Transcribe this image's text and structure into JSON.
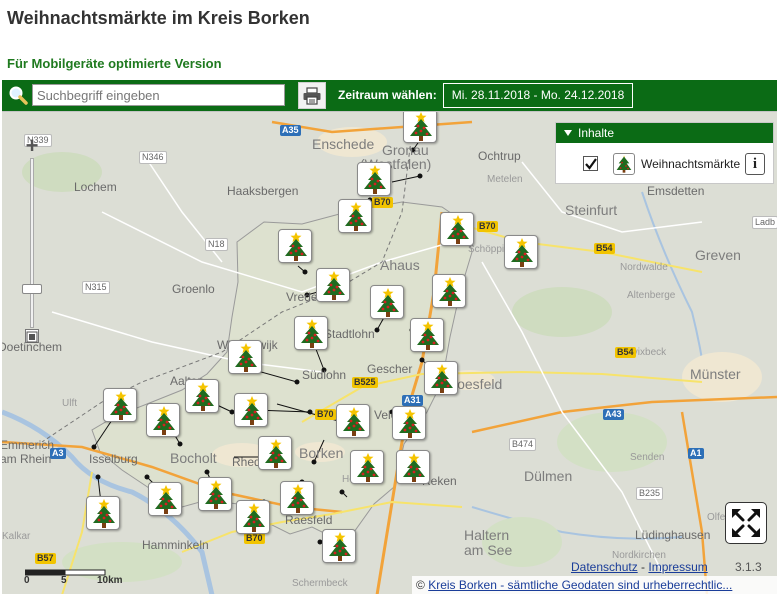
{
  "page": {
    "title": "Weihnachtsmärkte im Kreis Borken",
    "mobile_link": "Für Mobilgeräte optimierte Version"
  },
  "toolbar": {
    "search_placeholder": "Suchbegriff eingeben",
    "period_label": "Zeitraum wählen:",
    "period_value": "Mi. 28.11.2018 - Mo. 24.12.2018",
    "search_icon": "magnifier-icon",
    "print_icon": "printer-icon"
  },
  "layer_panel": {
    "title": "Inhalte",
    "layer_label": "Weihnachtsmärkte",
    "layer_checked": true,
    "info_label": "i"
  },
  "map": {
    "places": [
      {
        "name": "Enschede",
        "class": "big"
      },
      {
        "name": "Gronau",
        "class": "big"
      },
      {
        "name": "(Westfalen)",
        "class": "big"
      },
      {
        "name": "Ochtrup",
        "class": "mid"
      },
      {
        "name": "Emsdetten",
        "class": "mid"
      },
      {
        "name": "Steinfurt",
        "class": "big"
      },
      {
        "name": "Metelen",
        "class": "small"
      },
      {
        "name": "Lochem",
        "class": "mid"
      },
      {
        "name": "Haaksbergen",
        "class": "mid"
      },
      {
        "name": "Groenlo",
        "class": "mid"
      },
      {
        "name": "Ahaus",
        "class": "big"
      },
      {
        "name": "Schöppingen",
        "class": "small"
      },
      {
        "name": "Greven",
        "class": "big"
      },
      {
        "name": "Nordwalde",
        "class": "small"
      },
      {
        "name": "Altenberge",
        "class": "small"
      },
      {
        "name": "Vreden",
        "class": "mid"
      },
      {
        "name": "Stadtlohn",
        "class": "mid"
      },
      {
        "name": "Gescher",
        "class": "mid"
      },
      {
        "name": "Winterswijk",
        "class": "mid"
      },
      {
        "name": "Doetinchem",
        "class": "mid"
      },
      {
        "name": "Südlohn",
        "class": "mid"
      },
      {
        "name": "Coesfeld",
        "class": "big"
      },
      {
        "name": "Havixbeck",
        "class": "small"
      },
      {
        "name": "Münster",
        "class": "big"
      },
      {
        "name": "Aalten",
        "class": "mid"
      },
      {
        "name": "Velen",
        "class": "mid"
      },
      {
        "name": "Ulft",
        "class": "small"
      },
      {
        "name": "Emmerich",
        "class": "mid"
      },
      {
        "name": "am Rhein",
        "class": "mid"
      },
      {
        "name": "Isselburg",
        "class": "mid"
      },
      {
        "name": "Bocholt",
        "class": "big"
      },
      {
        "name": "Rhede",
        "class": "mid"
      },
      {
        "name": "Borken",
        "class": "big"
      },
      {
        "name": "Heiden",
        "class": "small"
      },
      {
        "name": "Reken",
        "class": "mid"
      },
      {
        "name": "Dülmen",
        "class": "big"
      },
      {
        "name": "Senden",
        "class": "small"
      },
      {
        "name": "Lüdinghausen",
        "class": "mid"
      },
      {
        "name": "Raesfeld",
        "class": "mid"
      },
      {
        "name": "Haltern",
        "class": "big"
      },
      {
        "name": "am See",
        "class": "big"
      },
      {
        "name": "Kalkar",
        "class": "small"
      },
      {
        "name": "Hamminkeln",
        "class": "mid"
      },
      {
        "name": "Schermbeck",
        "class": "small"
      },
      {
        "name": "Nordkirchen",
        "class": "small"
      },
      {
        "name": "Olfen",
        "class": "small"
      }
    ],
    "roads": [
      {
        "label": "N339",
        "kind": "n"
      },
      {
        "label": "A35",
        "kind": "a"
      },
      {
        "label": "N346",
        "kind": "n"
      },
      {
        "label": "N18",
        "kind": "n"
      },
      {
        "label": "N315",
        "kind": "n"
      },
      {
        "label": "B70",
        "kind": "b"
      },
      {
        "label": "B70",
        "kind": "b"
      },
      {
        "label": "B54",
        "kind": "b"
      },
      {
        "label": "B54",
        "kind": "b"
      },
      {
        "label": "B525",
        "kind": "b"
      },
      {
        "label": "A31",
        "kind": "a"
      },
      {
        "label": "A43",
        "kind": "a"
      },
      {
        "label": "B70",
        "kind": "b"
      },
      {
        "label": "B474",
        "kind": "n"
      },
      {
        "label": "A3",
        "kind": "a"
      },
      {
        "label": "A1",
        "kind": "a"
      },
      {
        "label": "B235",
        "kind": "n"
      },
      {
        "label": "B70",
        "kind": "b"
      },
      {
        "label": "B57",
        "kind": "b"
      },
      {
        "label": "Ladb",
        "kind": "n"
      }
    ],
    "marker_icon": "christmas-tree-icon",
    "marker_count": 30
  },
  "scale": {
    "labels": [
      "0",
      "5",
      "10km"
    ]
  },
  "footer": {
    "privacy": "Datenschutz",
    "separator": "-",
    "imprint": "Impressum",
    "version": "3.1.3",
    "copyright_symbol": "©",
    "copyright_link": "Kreis Borken - sämtliche Geodaten sind urheberrechtlic..."
  },
  "colors": {
    "toolbar_green": "#0b6b15",
    "tree_green": "#1f6b1f",
    "tree_trunk": "#7a3f12",
    "ornament_red": "#d42020",
    "star_yellow": "#f5c400"
  }
}
